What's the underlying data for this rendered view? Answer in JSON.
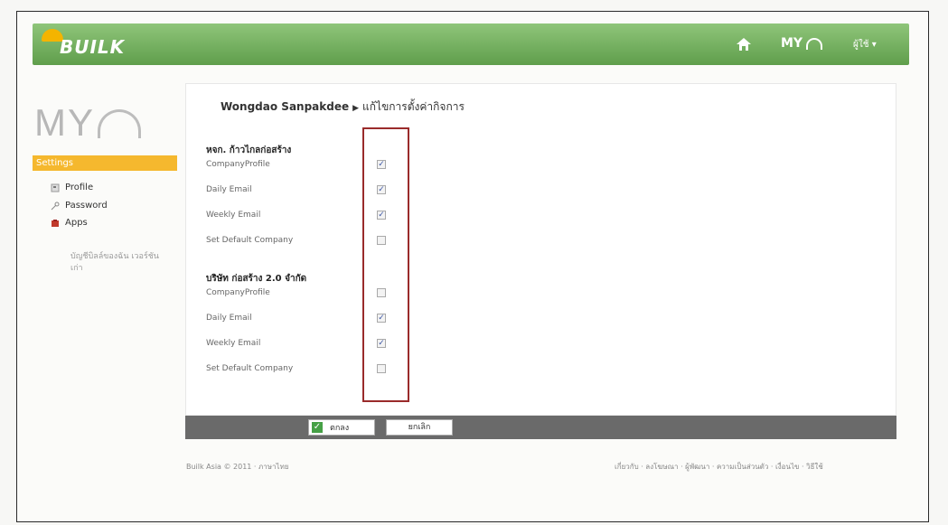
{
  "header": {
    "logo": "BUILK",
    "my_label": "MY",
    "user_menu": "ผู้ใช้ ▾"
  },
  "sidebar": {
    "brand": "MY",
    "section": "Settings",
    "items": [
      {
        "label": "Profile",
        "icon": "profile-icon"
      },
      {
        "label": "Password",
        "icon": "key-icon"
      },
      {
        "label": "Apps",
        "icon": "apps-icon"
      }
    ],
    "note": "บัญชีบิลล์ของฉัน เวอร์ชันเก่า"
  },
  "breadcrumb": {
    "user": "Wongdao Sanpakdee",
    "page": "แก้ไขการตั้งค่ากิจการ"
  },
  "groups": [
    {
      "name": "หจก. ก้าวไกลก่อสร้าง",
      "rows": [
        {
          "label": "CompanyProfile",
          "checked": true
        },
        {
          "label": "Daily Email",
          "checked": true
        },
        {
          "label": "Weekly Email",
          "checked": true
        },
        {
          "label": "Set Default Company",
          "checked": false
        }
      ]
    },
    {
      "name": "บริษัท ก่อสร้าง 2.0 จำกัด",
      "rows": [
        {
          "label": "CompanyProfile",
          "checked": false
        },
        {
          "label": "Daily Email",
          "checked": true
        },
        {
          "label": "Weekly Email",
          "checked": true
        },
        {
          "label": "Set Default Company",
          "checked": false
        }
      ]
    }
  ],
  "actions": {
    "ok": "ตกลง",
    "cancel": "ยกเลิก"
  },
  "footer": {
    "left": "Builk Asia © 2011 · ภาษาไทย",
    "right": "เกี่ยวกับ · ลงโฆษณา · ผู้พัฒนา · ความเป็นส่วนตัว · เงื่อนไข · วิธีใช้"
  },
  "colors": {
    "topbar": "#6fae58",
    "accent": "#f5b82e",
    "highlight_box": "#9a2b2b"
  }
}
